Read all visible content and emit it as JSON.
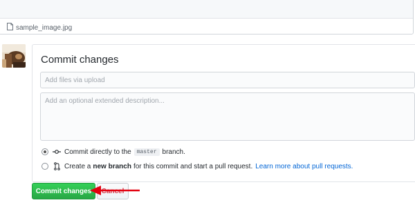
{
  "upload": {
    "file_name": "sample_image.jpg"
  },
  "commit": {
    "title": "Commit changes",
    "summary_placeholder": "Add files via upload",
    "description_placeholder": "Add an optional extended description...",
    "option_direct": {
      "text_before": "Commit directly to the",
      "branch": "master",
      "text_after": "branch.",
      "selected": true
    },
    "option_new_branch": {
      "text_before": "Create a",
      "bold_text": "new branch",
      "text_after": "for this commit and start a pull request.",
      "link_text": "Learn more about pull requests.",
      "selected": false
    },
    "commit_button_label": "Commit changes",
    "cancel_button_label": "Cancel"
  },
  "colors": {
    "commit_button": "#28a745",
    "cancel_text": "#d73a49",
    "link": "#0366d6",
    "annotation_arrow": "#e3000f"
  },
  "icons": [
    "file-icon",
    "git-commit-icon",
    "git-pull-request-icon",
    "red-arrow-annotation"
  ]
}
